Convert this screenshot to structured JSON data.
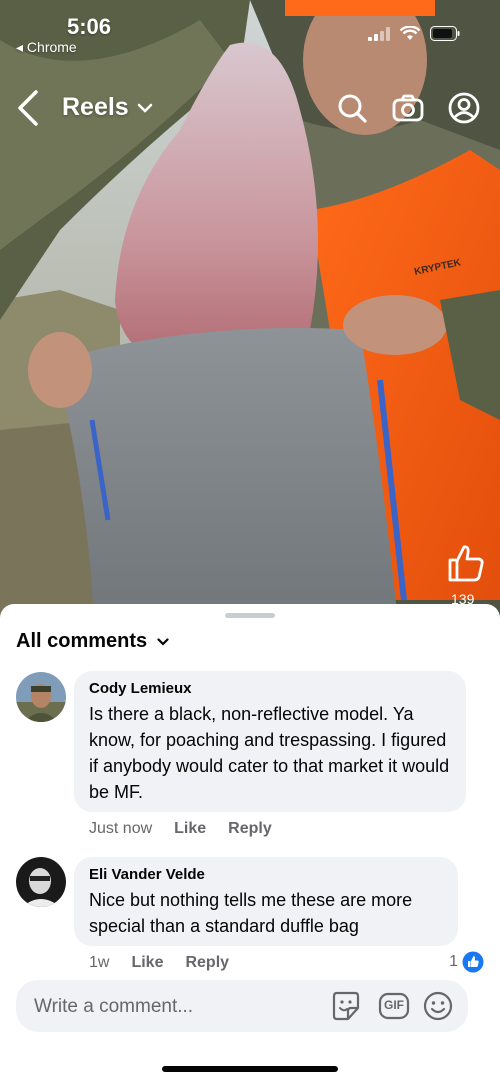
{
  "status_bar": {
    "time": "5:06",
    "back_app": "◂ Chrome"
  },
  "header": {
    "title": "Reels"
  },
  "reel": {
    "like_count": "139"
  },
  "comments": {
    "sort_label": "All comments",
    "items": [
      {
        "author": "Cody Lemieux",
        "text": "Is there a black, non-reflective model.  Ya know, for poaching and trespassing. I figured if anybody would cater to that market it would be MF.",
        "time": "Just now",
        "like_label": "Like",
        "reply_label": "Reply"
      },
      {
        "author": "Eli Vander Velde",
        "text": "Nice but nothing tells me these are more special than a standard duffle bag",
        "time": "1w",
        "like_label": "Like",
        "reply_label": "Reply",
        "reaction_count": "1"
      }
    ]
  },
  "composer": {
    "placeholder": "Write a comment...",
    "gif_label": "GIF"
  },
  "colors": {
    "accent": "#1877f2",
    "bubble": "#f0f2f5",
    "secondary_text": "#65676b"
  }
}
